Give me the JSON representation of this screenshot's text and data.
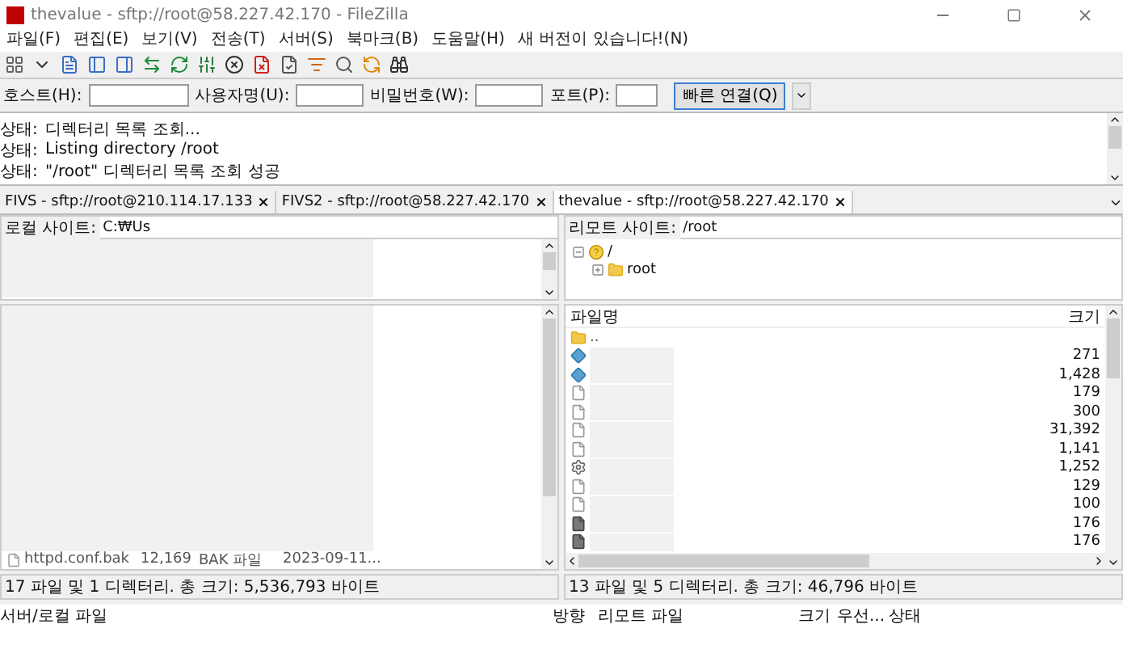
{
  "window": {
    "title": "thevalue - sftp://root@58.227.42.170 - FileZilla"
  },
  "menu": [
    "파일(F)",
    "편집(E)",
    "보기(V)",
    "전송(T)",
    "서버(S)",
    "북마크(B)",
    "도움말(H)",
    "새 버전이 있습니다!(N)"
  ],
  "quickconnect": {
    "fields": [
      {
        "label": "호스트(H):"
      },
      {
        "label": "사용자명(U):"
      },
      {
        "label": "비밀번호(W):"
      },
      {
        "label": "포트(P):"
      }
    ],
    "button": "빠른 연결(Q)"
  },
  "log": [
    {
      "label": "상태:",
      "message": "디렉터리 목록 조회..."
    },
    {
      "label": "상태:",
      "message": "Listing directory /root"
    },
    {
      "label": "상태:",
      "message": "\"/root\" 디렉터리 목록 조회 성공"
    }
  ],
  "tabs": [
    {
      "label": "FIVS - sftp://root@210.114.17.133",
      "selected": false
    },
    {
      "label": "FIVS2 - sftp://root@58.227.42.170",
      "selected": false
    },
    {
      "label": "thevalue - sftp://root@58.227.42.170",
      "selected": true
    }
  ],
  "local": {
    "site_label": "로컬 사이트:",
    "path": "C:₩Us",
    "rows": [
      {
        "name": "httpd.conf.bak",
        "size": "12,169",
        "type": "BAK 파일",
        "date": "2023-09-11..."
      }
    ],
    "status": "17 파일 및 1 디렉터리. 총 크기: 5,536,793 바이트"
  },
  "remote": {
    "site_label": "리모트 사이트:",
    "path": "/root",
    "tree": [
      {
        "label": "/",
        "expanded": true,
        "children": [
          {
            "label": "root",
            "expanded": false
          }
        ]
      }
    ],
    "columns": [
      "파일명",
      "크기"
    ],
    "rows": [
      {
        "kind": "folder",
        "name": ".."
      },
      {
        "kind": "script",
        "size": "271"
      },
      {
        "kind": "script",
        "size": "1,428"
      },
      {
        "kind": "file",
        "size": "179"
      },
      {
        "kind": "file",
        "size": "300"
      },
      {
        "kind": "file",
        "size": "31,392"
      },
      {
        "kind": "file",
        "size": "1,141"
      },
      {
        "kind": "config",
        "size": "1,252"
      },
      {
        "kind": "file",
        "size": "129"
      },
      {
        "kind": "file",
        "size": "100"
      },
      {
        "kind": "binary",
        "size": "176"
      },
      {
        "kind": "binary",
        "size": "176"
      }
    ],
    "status": "13 파일 및 5 디렉터리. 총 크기: 46,796 바이트"
  },
  "queue": {
    "columns": [
      "서버/로컬 파일",
      "방향",
      "리모트 파일",
      "크기",
      "우선...",
      "상태"
    ]
  }
}
